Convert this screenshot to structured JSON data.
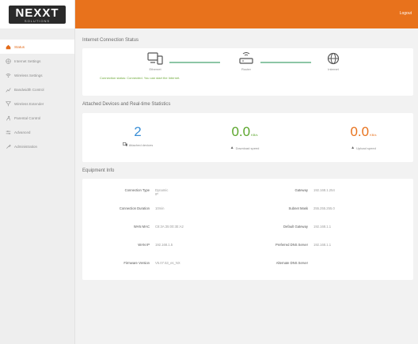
{
  "brand": {
    "logo_text": "NEXXT",
    "logo_tag": "SOLUTIONS"
  },
  "topbar": {
    "logout_label": "Logout"
  },
  "sidebar": {
    "items": [
      {
        "label": "Status",
        "icon": "home-icon",
        "active": true
      },
      {
        "label": "Internet Settings",
        "icon": "globe-icon",
        "active": false
      },
      {
        "label": "Wireless Settings",
        "icon": "wifi-icon",
        "active": false
      },
      {
        "label": "Bandwidth Control",
        "icon": "bandwidth-icon",
        "active": false
      },
      {
        "label": "Wireless Extender",
        "icon": "extender-icon",
        "active": false
      },
      {
        "label": "Parental Control",
        "icon": "parental-icon",
        "active": false
      },
      {
        "label": "Advanced",
        "icon": "sliders-icon",
        "active": false
      },
      {
        "label": "Administration",
        "icon": "tools-icon",
        "active": false
      }
    ]
  },
  "internet": {
    "title": "Internet Connection Status",
    "nodes": [
      {
        "label": "Ethernet",
        "icon": "devices-icon"
      },
      {
        "label": "Router",
        "icon": "router-icon"
      },
      {
        "label": "Internet",
        "icon": "globe-icon"
      }
    ],
    "status_text": "Connection status: Connected. You can start the Internet."
  },
  "attached": {
    "title": "Attached Devices and Real-time Statistics",
    "stats": [
      {
        "value": "2",
        "unit": "",
        "label": "Attached devices",
        "color": "#3a8fd6",
        "icon": "devices-icon"
      },
      {
        "value": "0.0",
        "unit": "KB/s",
        "label": "Download speed",
        "color": "#5aa52a",
        "icon": "download-icon"
      },
      {
        "value": "0.0",
        "unit": "KB/s",
        "label": "Upload speed",
        "color": "#e8721c",
        "icon": "upload-icon"
      }
    ]
  },
  "equipment": {
    "title": "Equipment Info",
    "left": [
      {
        "label": "Connection Type",
        "value": "Dynamic IP"
      },
      {
        "label": "Connection Duration",
        "value": "10min"
      },
      {
        "label": "WAN MAC",
        "value": "C8:3A:35:00:3E:A2"
      },
      {
        "label": "WAN IP",
        "value": "192.168.1.5"
      },
      {
        "label": "Firmware Version",
        "value": "V5.07.53_es_NX"
      }
    ],
    "right": [
      {
        "label": "Gateway",
        "value": "192.168.1.254"
      },
      {
        "label": "Subnet Mask",
        "value": "255.255.255.0"
      },
      {
        "label": "Default Gateway",
        "value": "192.168.1.1"
      },
      {
        "label": "Preferred DNS Server",
        "value": "192.168.1.1"
      },
      {
        "label": "Alternate DNS Server",
        "value": ""
      }
    ]
  },
  "colors": {
    "accent": "#e8721c",
    "line": "#8cc6a6",
    "status_ok": "#6ea93a"
  }
}
